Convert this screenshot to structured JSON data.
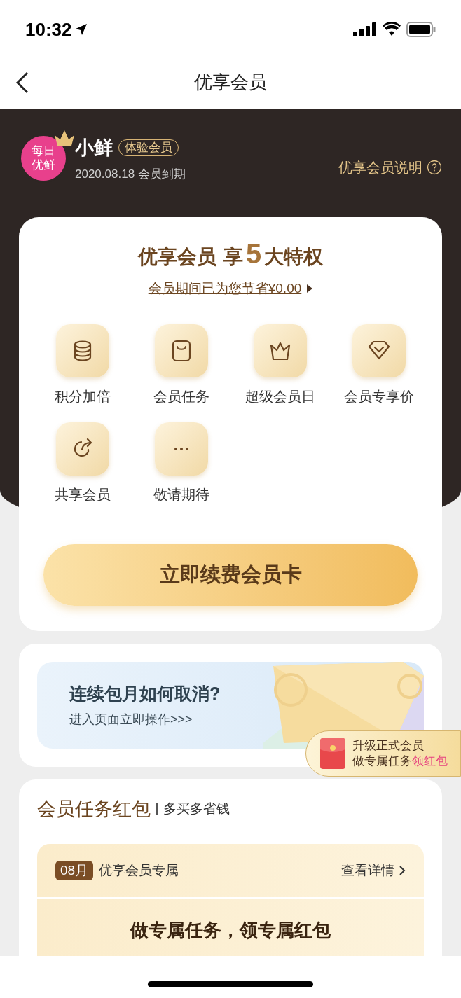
{
  "status_bar": {
    "time": "10:32"
  },
  "nav": {
    "title": "优享会员"
  },
  "profile": {
    "logo_lines": [
      "每日",
      "优鲜"
    ],
    "name": "小鲜",
    "badge": "体验会员",
    "expiry": "2020.08.18 会员到期",
    "help_link": "优享会员说明"
  },
  "privileges": {
    "title_prefix": "优享会员",
    "title_mid": "享",
    "title_number": "5",
    "title_suffix": "大特权",
    "savings": "会员期间已为您节省¥0.00",
    "items": [
      {
        "label": "积分加倍"
      },
      {
        "label": "会员任务"
      },
      {
        "label": "超级会员日"
      },
      {
        "label": "会员专享价"
      },
      {
        "label": "共享会员"
      },
      {
        "label": "敬请期待"
      }
    ],
    "renew_button": "立即续费会员卡"
  },
  "banner": {
    "title": "连续包月如何取消?",
    "subtitle": "进入页面立即操作>>>"
  },
  "floating_badge": {
    "line1": "升级正式会员",
    "line2_prefix": "做专属任务",
    "line2_highlight": "领红包"
  },
  "tasks": {
    "title_a": "会员任务",
    "title_b": "红包",
    "subtitle": "多买多省钱",
    "month": "08月",
    "label": "优享会员专属",
    "details_link": "查看详情",
    "heading": "做专属任务，领专属红包"
  }
}
